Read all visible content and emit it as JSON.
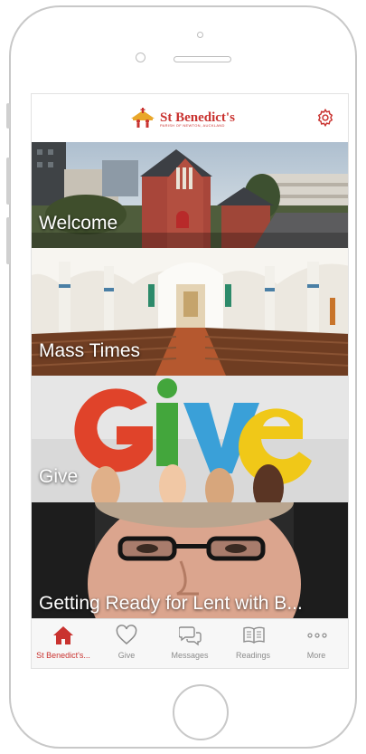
{
  "app": {
    "name": "St Benedict's",
    "subtitle": "PARISH OF NEWTON, AUCKLAND"
  },
  "header": {
    "settings_icon": "gear-icon"
  },
  "tiles": [
    {
      "label": "Welcome"
    },
    {
      "label": "Mass Times"
    },
    {
      "label": "Give"
    },
    {
      "label": "Getting Ready for Lent  with B..."
    }
  ],
  "tabbar": {
    "active_color": "#c9322f",
    "inactive_color": "#8c8c8c",
    "tabs": [
      {
        "label": "St Benedict's...",
        "icon": "home-icon",
        "active": true
      },
      {
        "label": "Give",
        "icon": "heart-icon",
        "active": false
      },
      {
        "label": "Messages",
        "icon": "chat-bubbles-icon",
        "active": false
      },
      {
        "label": "Readings",
        "icon": "open-book-icon",
        "active": false
      },
      {
        "label": "More",
        "icon": "more-dots-icon",
        "active": false
      }
    ]
  }
}
